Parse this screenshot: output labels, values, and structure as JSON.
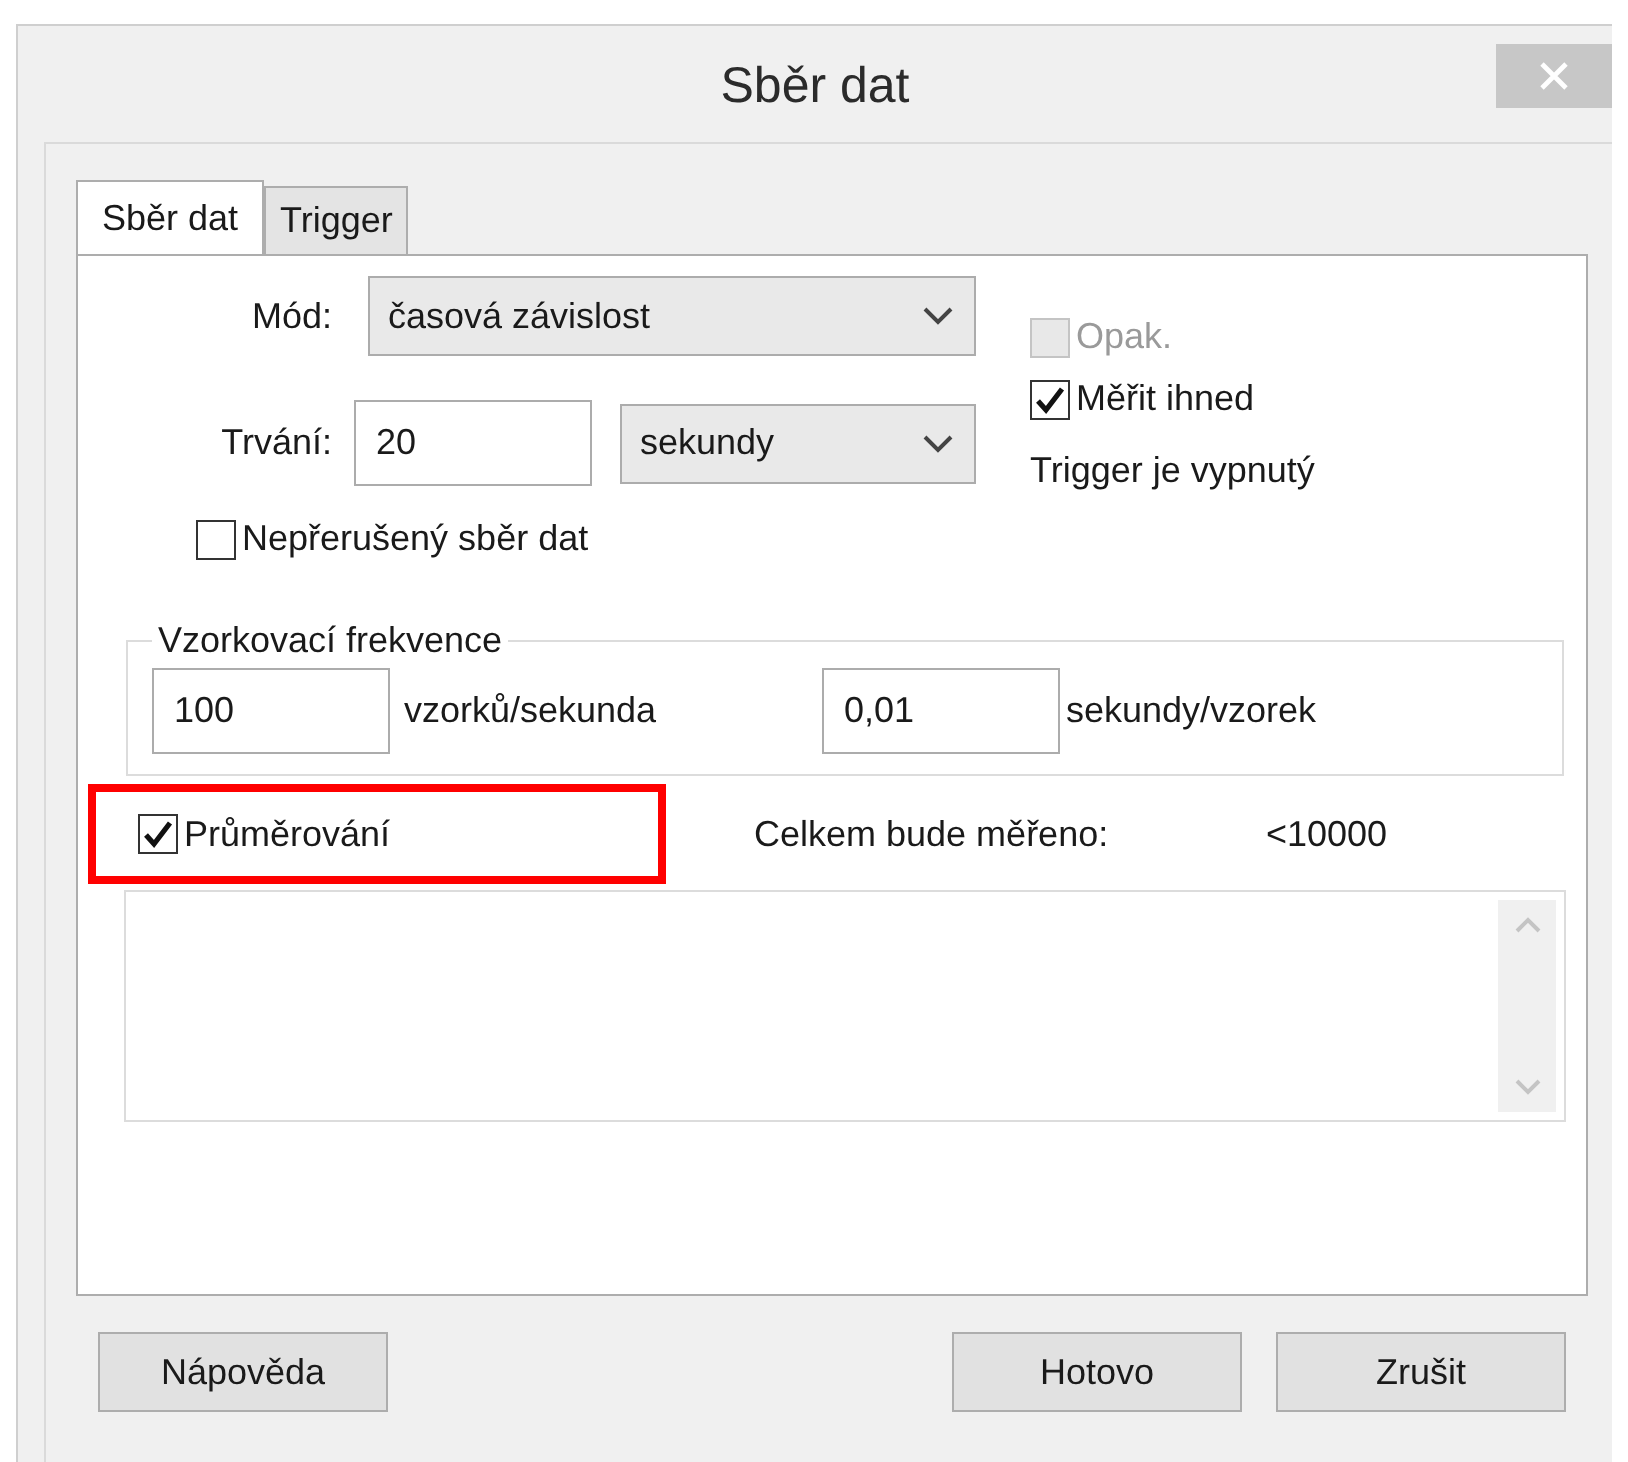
{
  "window": {
    "title": "Sběr dat"
  },
  "tabs": [
    {
      "label": "Sběr dat",
      "selected": true
    },
    {
      "label": "Trigger",
      "selected": false
    }
  ],
  "mode": {
    "label": "Mód:",
    "value": "časová závislost"
  },
  "duration": {
    "label": "Trvání:",
    "value": "20",
    "unit": "sekundy"
  },
  "continuous": {
    "label": "Nepřerušený sběr dat",
    "checked": false,
    "disabled": false
  },
  "repeat": {
    "label": "Opak.",
    "checked": false,
    "disabled": true
  },
  "measure_now": {
    "label": "Měřit ihned",
    "checked": true,
    "disabled": false
  },
  "trigger_status": "Trigger je vypnutý",
  "sampling": {
    "title": "Vzorkovací frekvence",
    "rate": "100",
    "rate_unit": "vzorků/sekunda",
    "interval": "0,01",
    "interval_unit": "sekundy/vzorek"
  },
  "averaging": {
    "label": "Průměrování",
    "checked": true,
    "disabled": false,
    "highlighted": true
  },
  "total": {
    "label": "Celkem bude měřeno:",
    "value": "<10000"
  },
  "buttons": [
    {
      "label": "Nápověda"
    },
    {
      "label": "Hotovo"
    },
    {
      "label": "Zrušit"
    }
  ]
}
